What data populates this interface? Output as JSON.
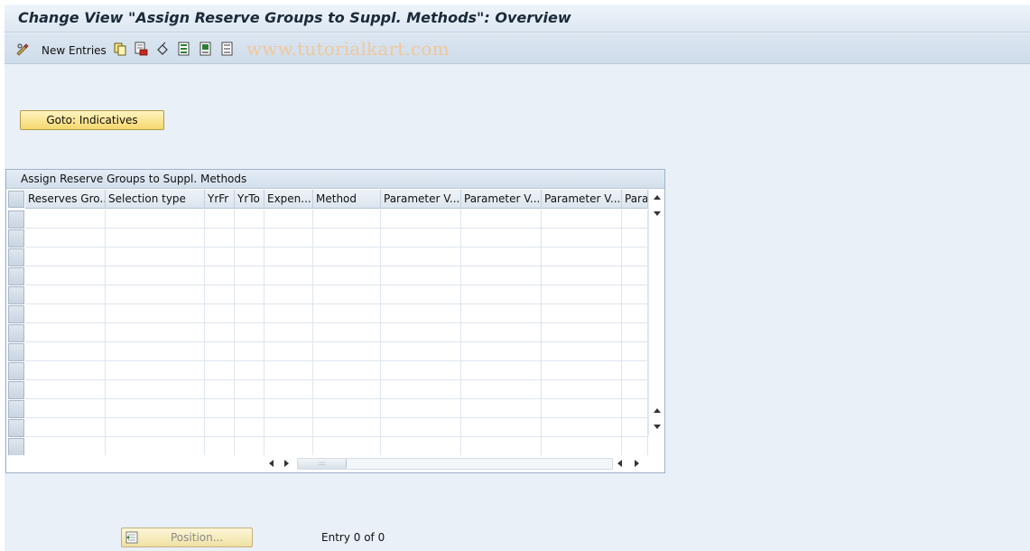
{
  "window": {
    "title": "Change View \"Assign Reserve Groups to Suppl. Methods\": Overview"
  },
  "toolbar": {
    "new_entries_label": "New Entries",
    "icons": [
      "glasses-edit-icon",
      "copy-icon",
      "delete-icon",
      "undo-change-icon",
      "select-all-icon",
      "select-block-icon",
      "deselect-all-icon"
    ],
    "watermark": "www.tutorialkart.com"
  },
  "buttons": {
    "goto_label": "Goto: Indicatives",
    "position_label": "Position..."
  },
  "table": {
    "title": "Assign Reserve Groups to Suppl. Methods",
    "columns": [
      "Reserves Gro...",
      "Selection type",
      "YrFr",
      "YrTo",
      "Expen...",
      "Method",
      "Parameter V...",
      "Parameter V...",
      "Parameter V...",
      "Parar"
    ],
    "rows": [],
    "visible_empty_rows": 13
  },
  "status": {
    "entry_text": "Entry 0 of 0"
  },
  "colors": {
    "background": "#e9f0f7",
    "button_yellow": "#f6d86e",
    "watermark": "#f0c79a"
  }
}
